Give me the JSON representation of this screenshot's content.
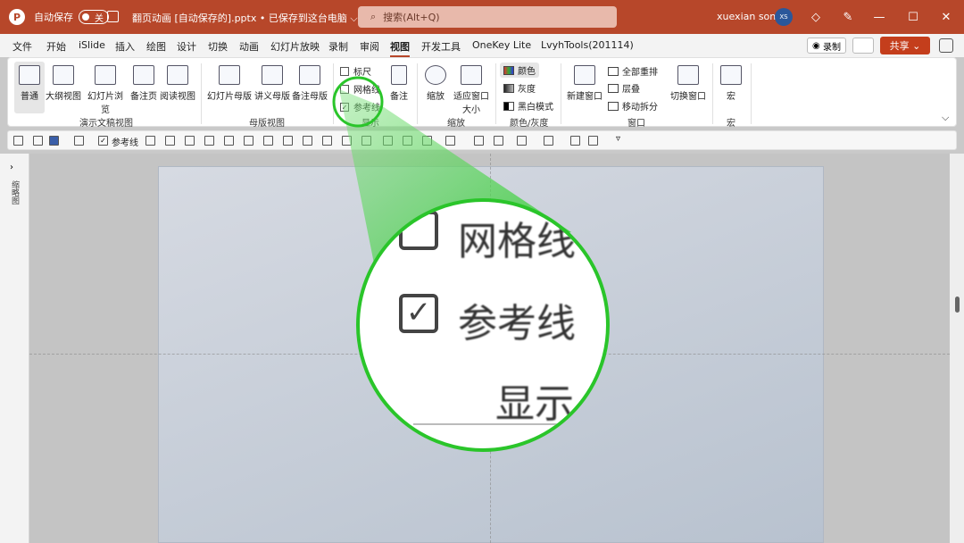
{
  "titlebar": {
    "autosave_label": "自动保存",
    "autosave_state": "关",
    "document_title": "翻页动画 [自动保存的].pptx • 已保存到这台电脑 ⌵",
    "search_placeholder": "搜索(Alt+Q)",
    "user_name": "xuexian song",
    "user_initials": "XS",
    "accent": "#b7472a"
  },
  "menu": {
    "items": [
      "文件",
      "开始",
      "iSlide",
      "插入",
      "绘图",
      "设计",
      "切换",
      "动画",
      "幻灯片放映",
      "录制",
      "审阅",
      "视图",
      "开发工具",
      "OneKey Lite",
      "LvyhTools(201114)"
    ],
    "active": "视图",
    "record_label": "录制",
    "share_label": "共享 ⌄"
  },
  "ribbon": {
    "views": {
      "normal": "普通",
      "outline": "大纲视图",
      "sorter": "幻灯片浏览",
      "notes_page": "备注页",
      "reading": "阅读视图",
      "label": "演示文稿视图"
    },
    "masters": {
      "slide_master": "幻灯片母版",
      "handout_master": "讲义母版",
      "notes_master": "备注母版",
      "label": "母版视图"
    },
    "show": {
      "ruler": "标尺",
      "gridlines": "网格线",
      "guides": "参考线",
      "notes": "备注",
      "label": "显示"
    },
    "zoom": {
      "zoom": "缩放",
      "fit": "适应窗口大小",
      "label": "缩放"
    },
    "color": {
      "color": "颜色",
      "grayscale": "灰度",
      "bw": "黑白模式",
      "label": "颜色/灰度"
    },
    "window": {
      "new_window": "新建窗口",
      "arrange_all": "全部重排",
      "cascade": "层叠",
      "move_split": "移动拆分",
      "switch": "切换窗口",
      "label": "窗口"
    },
    "macros": {
      "macro": "宏",
      "label": "宏"
    }
  },
  "qat": {
    "guides_label": "参考线"
  },
  "leftpane": {
    "label": "缩略图"
  },
  "zoom_callout": {
    "gridlines": "网格线",
    "guides": "参考线",
    "show": "显示",
    "ring_color": "#2ac52a"
  }
}
